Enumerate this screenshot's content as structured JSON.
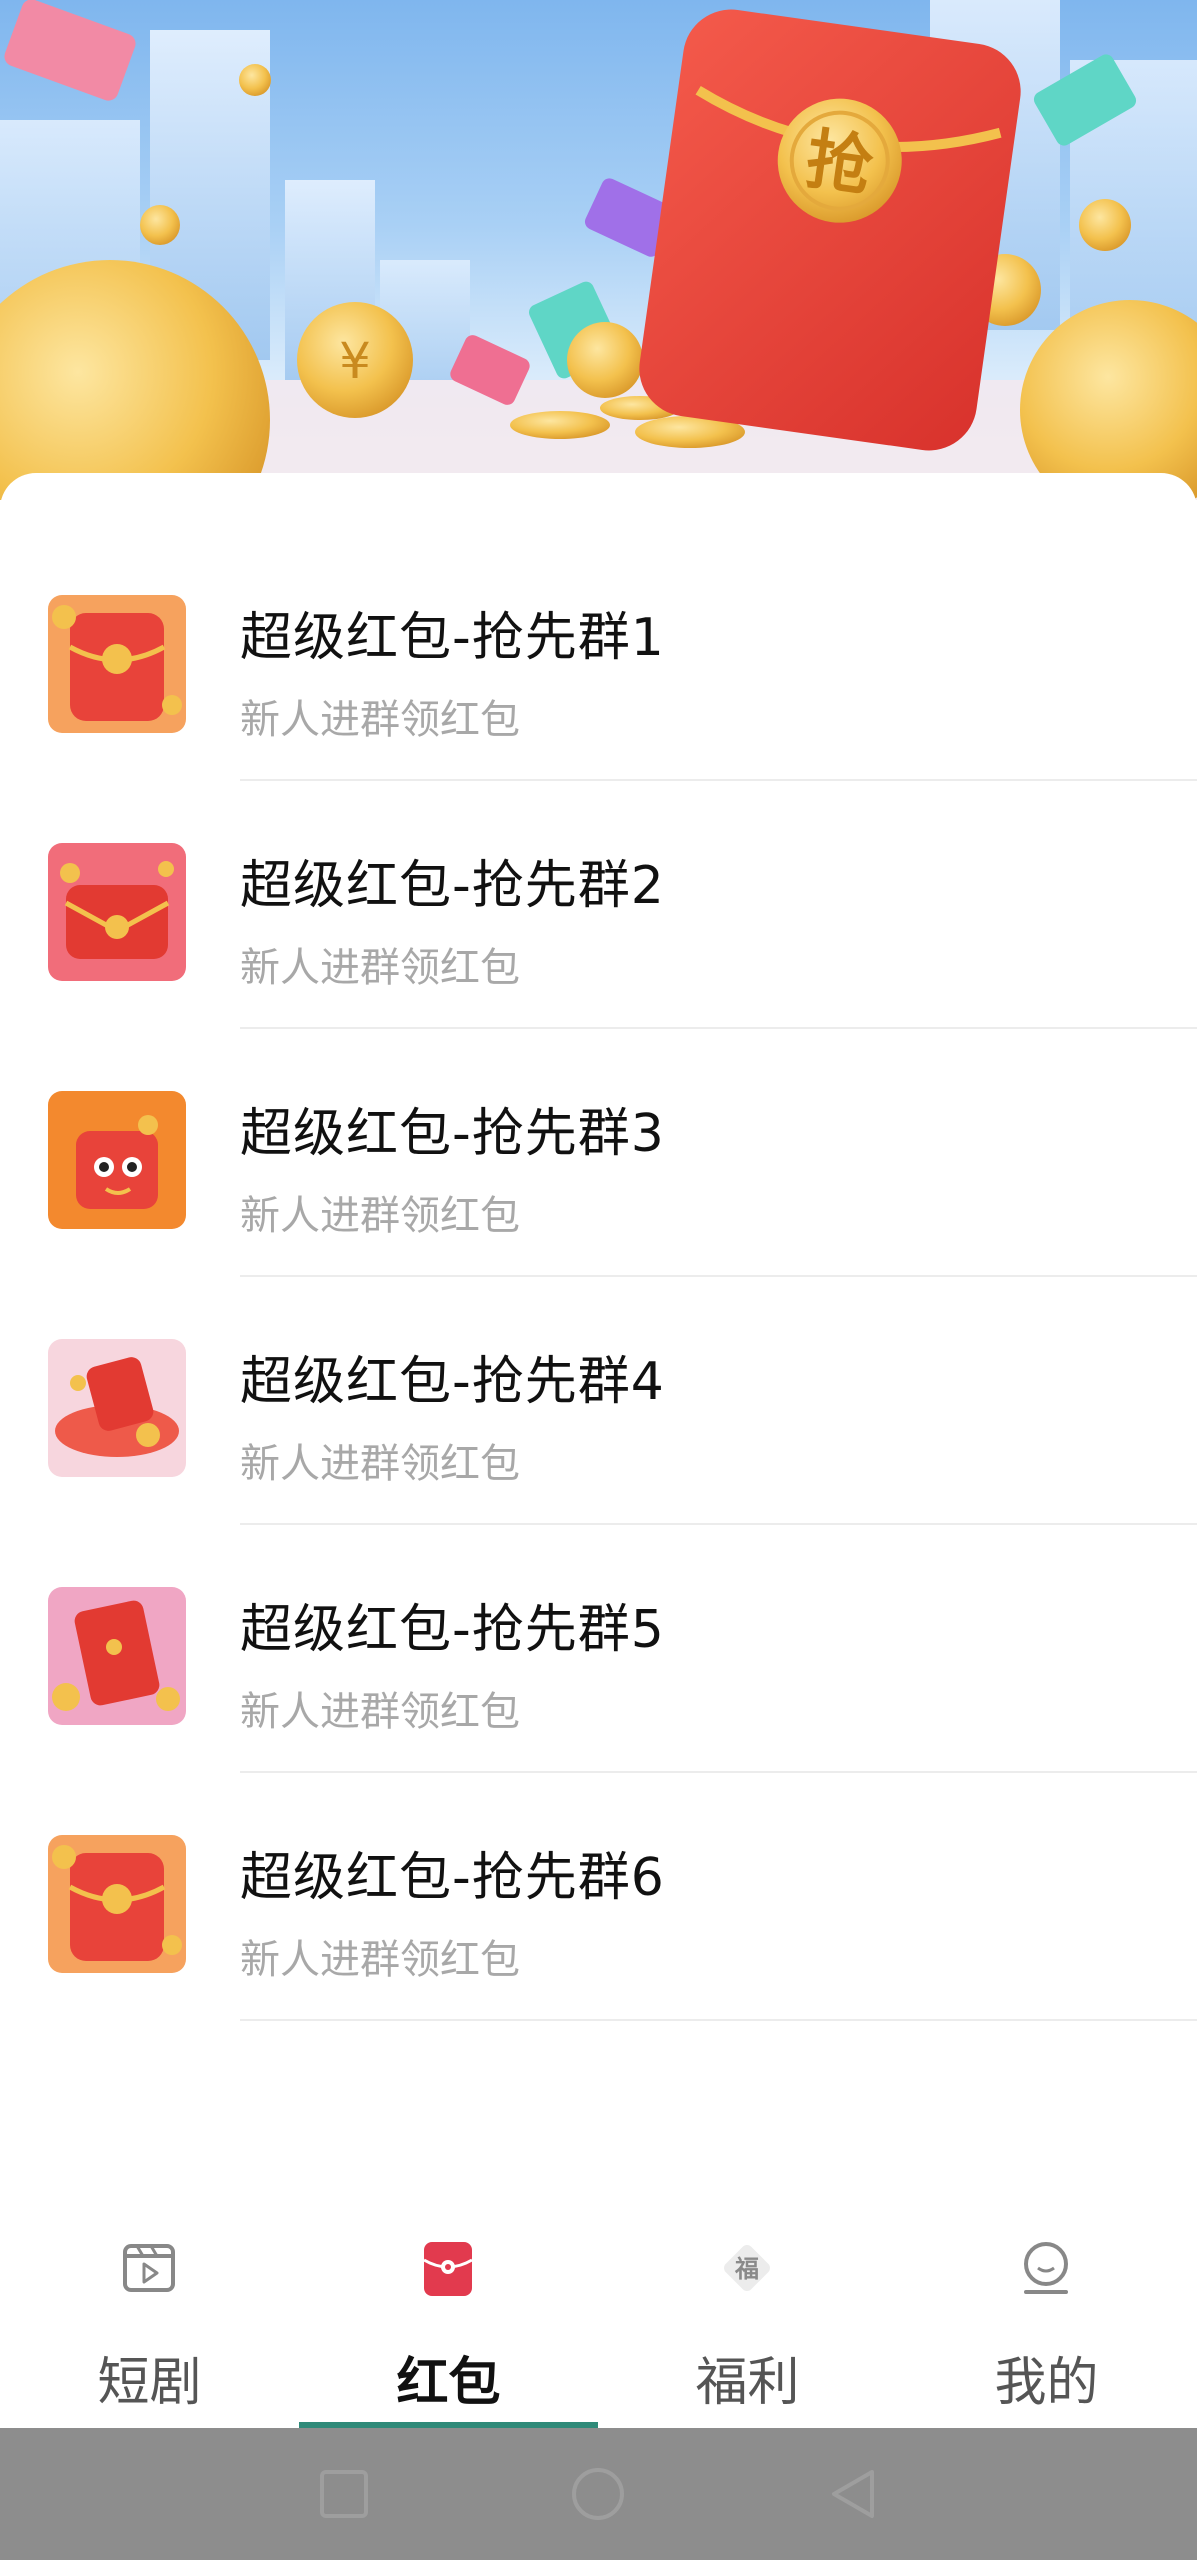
{
  "banner": {
    "envelope_glyph": "抢",
    "coin_glyph": "¥"
  },
  "groups": [
    {
      "title": "超级红包-抢先群1",
      "subtitle": "新人进群领红包"
    },
    {
      "title": "超级红包-抢先群2",
      "subtitle": "新人进群领红包"
    },
    {
      "title": "超级红包-抢先群3",
      "subtitle": "新人进群领红包"
    },
    {
      "title": "超级红包-抢先群4",
      "subtitle": "新人进群领红包"
    },
    {
      "title": "超级红包-抢先群5",
      "subtitle": "新人进群领红包"
    },
    {
      "title": "超级红包-抢先群6",
      "subtitle": "新人进群领红包"
    }
  ],
  "tabs": [
    {
      "label": "短剧",
      "icon": "play-clapper-icon",
      "active": false
    },
    {
      "label": "红包",
      "icon": "red-packet-icon",
      "active": true
    },
    {
      "label": "福利",
      "icon": "fu-diamond-icon",
      "icon_text": "福",
      "active": false
    },
    {
      "label": "我的",
      "icon": "profile-icon",
      "active": false
    }
  ],
  "colors": {
    "accent": "#2f8a79",
    "red_packet": "#e8433a",
    "gold": "#f2c04a",
    "title_text": "#111111",
    "subtitle_text": "#a8a8a8",
    "system_nav": "#8d8d8d"
  }
}
